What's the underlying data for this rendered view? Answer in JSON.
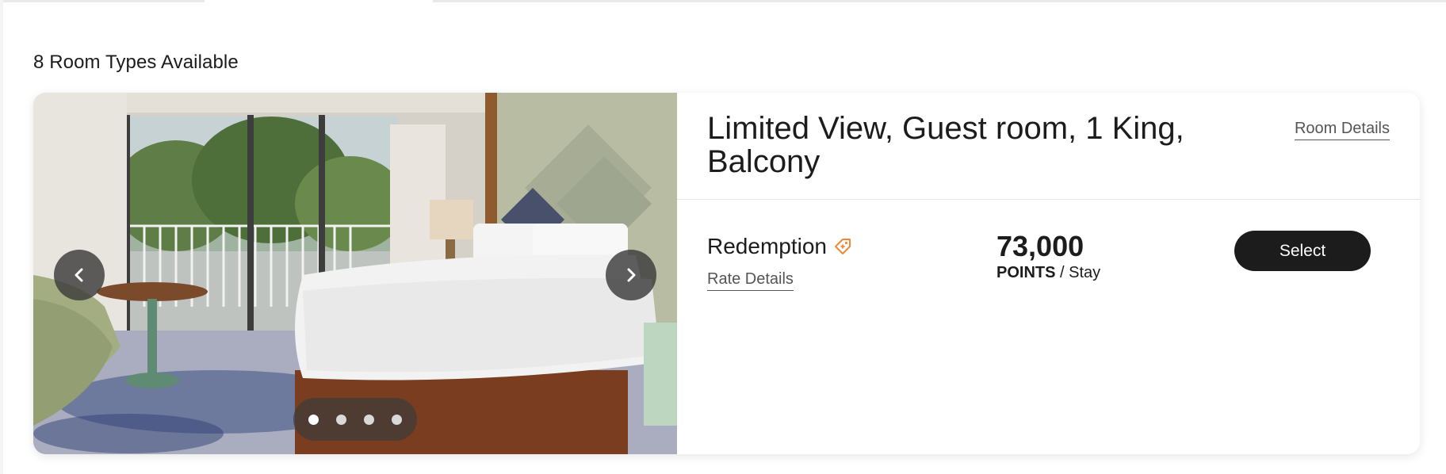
{
  "results": {
    "count_label": "8 Room Types Available"
  },
  "room": {
    "title": "Limited View, Guest room, 1 King, Balcony",
    "room_details_label": "Room Details",
    "carousel": {
      "prev_icon": "chevron-left-icon",
      "next_icon": "chevron-right-icon",
      "dot_count": 4,
      "active_dot": 0
    },
    "rate": {
      "name": "Redemption",
      "tag_icon": "price-tag-icon",
      "tag_icon_color": "#f0883a",
      "details_label": "Rate Details",
      "price": "73,000",
      "price_unit": "POINTS",
      "price_suffix": " / Stay",
      "select_label": "Select"
    }
  }
}
